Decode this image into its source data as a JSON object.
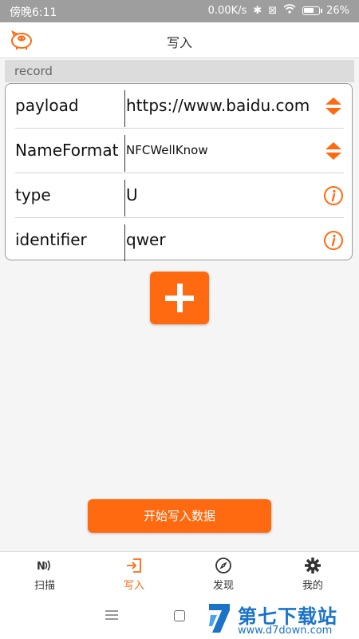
{
  "status_bar": {
    "time": "傍晚6:11",
    "network_speed": "0.00K/s",
    "battery": "26%"
  },
  "header": {
    "title": "写入",
    "logo_icon": "pig-logo-icon"
  },
  "section": {
    "title": "record"
  },
  "record_fields": [
    {
      "label": "payload",
      "value": "https://www.baidu.com",
      "icon": "sort-arrows-icon"
    },
    {
      "label": "NameFormat",
      "value": "NFCWellKnow",
      "icon": "sort-arrows-icon"
    },
    {
      "label": "type",
      "value": "U",
      "icon": "info-icon"
    },
    {
      "label": "identifier",
      "value": "qwer",
      "icon": "info-icon"
    }
  ],
  "actions": {
    "add_icon": "plus-icon",
    "start_button": "开始写入数据"
  },
  "tabs": [
    {
      "label": "扫描",
      "icon": "nfc-icon",
      "active": false
    },
    {
      "label": "写入",
      "icon": "write-icon",
      "active": true
    },
    {
      "label": "发现",
      "icon": "compass-icon",
      "active": false
    },
    {
      "label": "我的",
      "icon": "gear-icon",
      "active": false
    }
  ],
  "watermark": {
    "title": "第七下载站",
    "url": "www.d7down.com"
  },
  "colors": {
    "accent": "#ff6a10",
    "status_bar": "#9e9e9e",
    "watermark": "#1a73c7"
  }
}
